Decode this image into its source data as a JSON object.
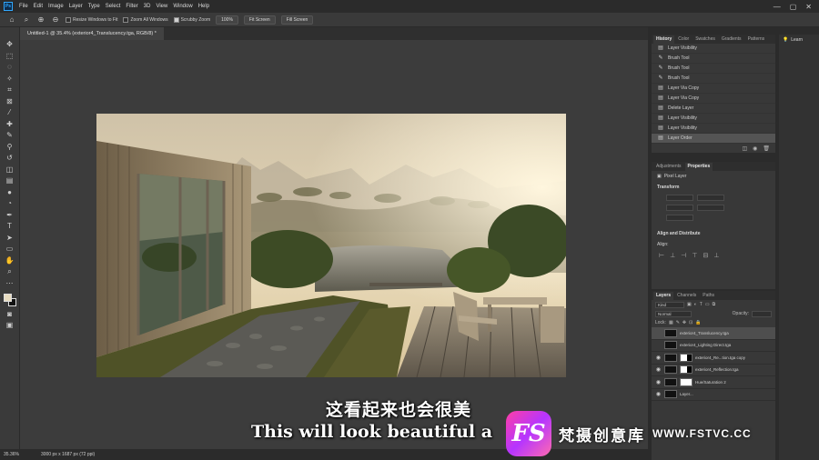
{
  "menubar": {
    "logo": "Ps",
    "items": [
      "File",
      "Edit",
      "Image",
      "Layer",
      "Type",
      "Select",
      "Filter",
      "3D",
      "View",
      "Window",
      "Help"
    ],
    "controls": [
      "—",
      "▢",
      "✕"
    ]
  },
  "options": {
    "resize_windows": "Resize Windows to Fit",
    "zoom_all": "Zoom All Windows",
    "scrubby_zoom": "Scrubby Zoom",
    "zoom_100": "100%",
    "fit_screen": "Fit Screen",
    "fill_screen": "Fill Screen"
  },
  "document": {
    "tab_title": "Untitled-1 @ 35.4% (exterior4_Translucency.tga, RGB/8) *"
  },
  "status": {
    "zoom": "35.36%",
    "size": "3000 px x 1687 px (72 ppi)"
  },
  "history": {
    "tabs": [
      "History",
      "Color",
      "Swatches",
      "Gradients",
      "Patterns"
    ],
    "items": [
      {
        "icon": "layers-icon",
        "label": "Layer Visibility"
      },
      {
        "icon": "brush-icon",
        "label": "Brush Tool"
      },
      {
        "icon": "brush-icon",
        "label": "Brush Tool"
      },
      {
        "icon": "brush-icon",
        "label": "Brush Tool"
      },
      {
        "icon": "layers-icon",
        "label": "Layer Via Copy"
      },
      {
        "icon": "layers-icon",
        "label": "Layer Via Copy"
      },
      {
        "icon": "layers-icon",
        "label": "Delete Layer"
      },
      {
        "icon": "layers-icon",
        "label": "Layer Visibility"
      },
      {
        "icon": "layers-icon",
        "label": "Layer Visibility"
      },
      {
        "icon": "layers-icon",
        "label": "Layer Order"
      }
    ]
  },
  "properties": {
    "tabs": [
      "Adjustments",
      "Properties"
    ],
    "pixel_layer": "Pixel Layer",
    "transform": "Transform",
    "align": "Align and Distribute",
    "align_sub": "Align:"
  },
  "layers": {
    "tabs": [
      "Layers",
      "Channels",
      "Paths"
    ],
    "kind": "Kind",
    "normal": "Normal",
    "opacity": "Opacity:",
    "lock": "Lock:",
    "items": [
      {
        "name": "exterior4_Translucency.tga",
        "visible": false,
        "mask": "none",
        "selected": true
      },
      {
        "name": "exterior4_Lighting Direct.tga",
        "visible": false,
        "mask": "none",
        "selected": false
      },
      {
        "name": "exterior4_Re...tion.tga copy",
        "visible": true,
        "mask": "partial",
        "selected": false
      },
      {
        "name": "exterior4_Reflection.tga",
        "visible": true,
        "mask": "partial",
        "selected": false
      },
      {
        "name": "Hue/Saturation 2",
        "visible": true,
        "mask": "white",
        "selected": false
      },
      {
        "name": "Layer...",
        "visible": true,
        "mask": "none",
        "selected": false
      }
    ]
  },
  "learn": {
    "label": "Learn"
  },
  "subtitle": {
    "chinese": "这看起来也会很美",
    "english": "This will look beautiful a"
  },
  "watermark": {
    "logo": "FS",
    "chinese": "梵摄创意库",
    "url": "WWW.FSTVC.CC"
  }
}
